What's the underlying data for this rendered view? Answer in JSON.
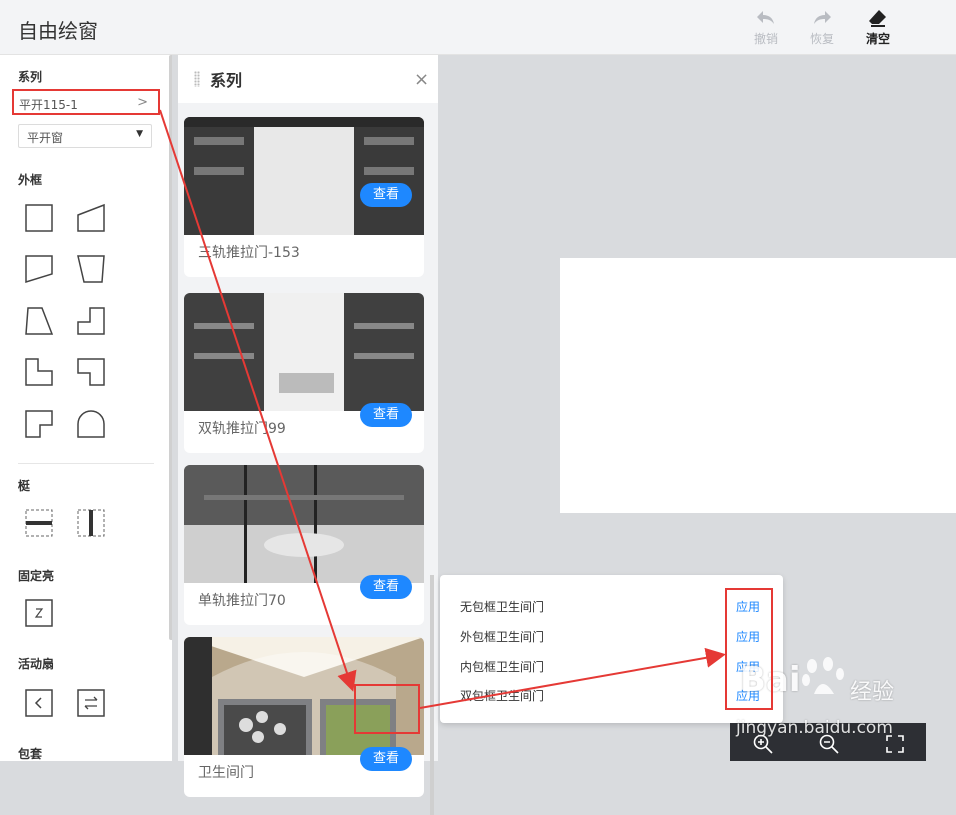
{
  "header": {
    "title": "自由绘窗",
    "toolbar": [
      {
        "label": "撤销",
        "icon": "undo-icon",
        "enabled": false
      },
      {
        "label": "恢复",
        "icon": "redo-icon",
        "enabled": false
      },
      {
        "label": "清空",
        "icon": "eraser-icon",
        "enabled": true
      }
    ]
  },
  "sidebar": {
    "series_title": "系列",
    "series_value": "平开115-1",
    "window_type": "平开窗",
    "frame_title": "外框",
    "mullion_title": "梃",
    "fixed_title": "固定亮",
    "sash_title": "活动扇",
    "trim_title": "包套"
  },
  "panel": {
    "title": "系列",
    "cards": [
      {
        "name": "三轨推拉门-153",
        "button": "查看"
      },
      {
        "name": "双轨推拉门99",
        "button": "查看"
      },
      {
        "name": "单轨推拉门70",
        "button": "查看"
      },
      {
        "name": "卫生间门",
        "button": "查看"
      }
    ]
  },
  "popup": {
    "options": [
      {
        "label": "无包框卫生间门",
        "action": "应用"
      },
      {
        "label": "外包框卫生间门",
        "action": "应用"
      },
      {
        "label": "内包框卫生间门",
        "action": "应用"
      },
      {
        "label": "双包框卫生间门",
        "action": "应用"
      }
    ]
  },
  "watermark": {
    "brand": "Bai",
    "brand2": "经验",
    "url": "jingyan.baidu.com"
  },
  "colors": {
    "accent": "#1e88ff",
    "annotation": "#e53935"
  }
}
